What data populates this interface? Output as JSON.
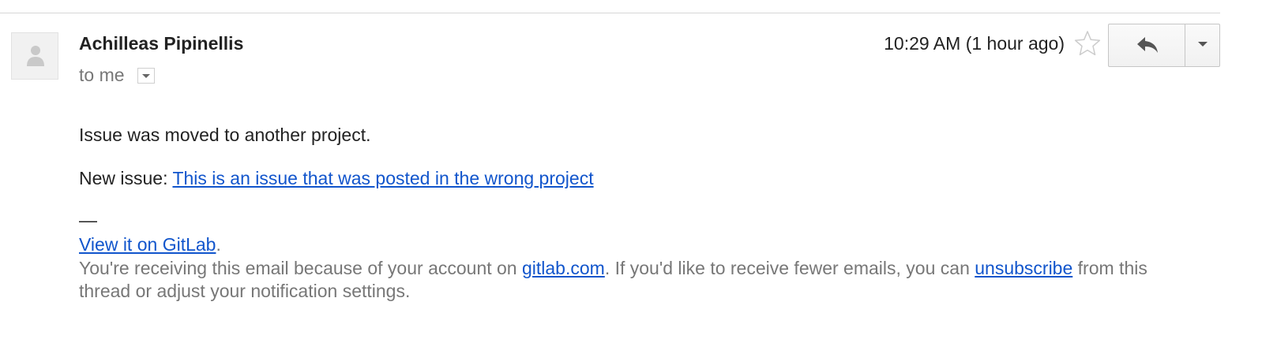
{
  "sender": {
    "name": "Achilleas Pipinellis",
    "recipient_label": "to me"
  },
  "header": {
    "timestamp": "10:29 AM (1 hour ago)",
    "star_icon": "star-outline-icon",
    "reply_icon": "reply-arrow-icon",
    "more_icon": "chevron-down-icon"
  },
  "message": {
    "intro": "Issue was moved to another project.",
    "new_issue_prefix": "New issue: ",
    "new_issue_link": "This is an issue that was posted in the wrong project",
    "signature_dash": "—",
    "view_link": "View it on GitLab",
    "view_suffix": ".",
    "footer_part1": "You're receiving this email because of your account on ",
    "footer_domain_link": "gitlab.com",
    "footer_part2": ". If you'd like to receive fewer emails, you can ",
    "footer_unsubscribe_link": "unsubscribe",
    "footer_part3": " from this thread or adjust your notification settings."
  },
  "colors": {
    "link": "#1155cc",
    "muted_text": "#777777",
    "body_text": "#222222"
  }
}
